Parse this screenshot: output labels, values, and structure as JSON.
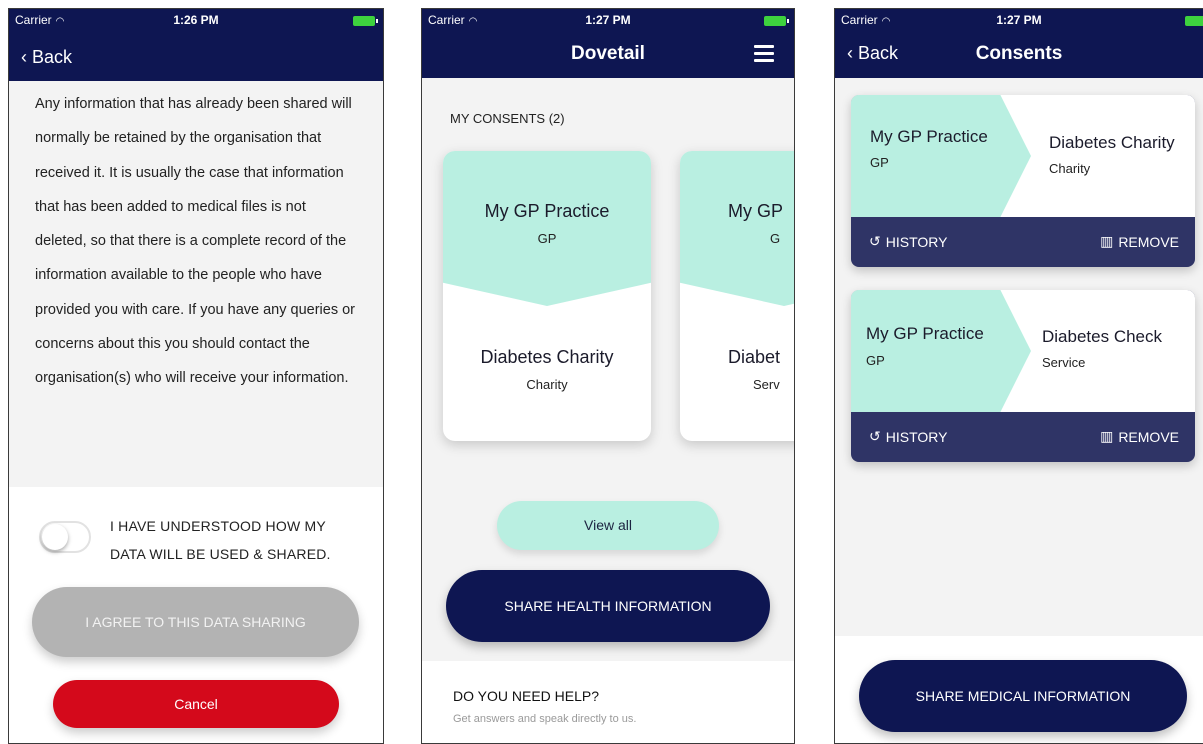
{
  "status": {
    "carrier": "Carrier",
    "time_1": "1:26 PM",
    "time_2": "1:27 PM",
    "time_3": "1:27 PM"
  },
  "panel1": {
    "back_label": "Back",
    "body_text": "Any information that has already been shared will normally be retained by the organisation that received it. It is usually the case that information that has been added to medical files is not deleted, so that there is a complete record of the information available to the people who have provided you with care. If you have any queries or concerns about this you should contact the organisation(s) who will receive your information.",
    "understand_label": "I HAVE UNDERSTOOD HOW MY DATA WILL BE USED & SHARED.",
    "agree_button": "I AGREE TO THIS DATA SHARING",
    "cancel_button": "Cancel"
  },
  "panel2": {
    "title": "Dovetail",
    "section_label": "MY CONSENTS (2)",
    "cards": [
      {
        "org": "My GP Practice",
        "org_type": "GP",
        "recipient": "Diabetes Charity",
        "recipient_type": "Charity"
      },
      {
        "org": "My GP",
        "org_type": "G",
        "recipient": "Diabet",
        "recipient_type": "Serv"
      }
    ],
    "view_all": "View all",
    "share_button": "SHARE HEALTH INFORMATION",
    "help_title": "DO YOU NEED HELP?",
    "help_subtitle": "Get answers and speak directly to us."
  },
  "panel3": {
    "back_label": "Back",
    "title": "Consents",
    "consents": [
      {
        "org": "My GP Practice",
        "org_type": "GP",
        "recipient": "Diabetes Charity",
        "recipient_type": "Charity",
        "history": "HISTORY",
        "remove": "REMOVE"
      },
      {
        "org": "My GP Practice",
        "org_type": "GP",
        "recipient": "Diabetes Check",
        "recipient_type": "Service",
        "history": "HISTORY",
        "remove": "REMOVE"
      }
    ],
    "share_button": "SHARE MEDICAL INFORMATION"
  },
  "colors": {
    "navy": "#0e1652",
    "mint": "#b9efe1",
    "card_footer": "#2f3466",
    "cancel_red": "#d4091b",
    "disabled_grey": "#b3b3b3"
  }
}
